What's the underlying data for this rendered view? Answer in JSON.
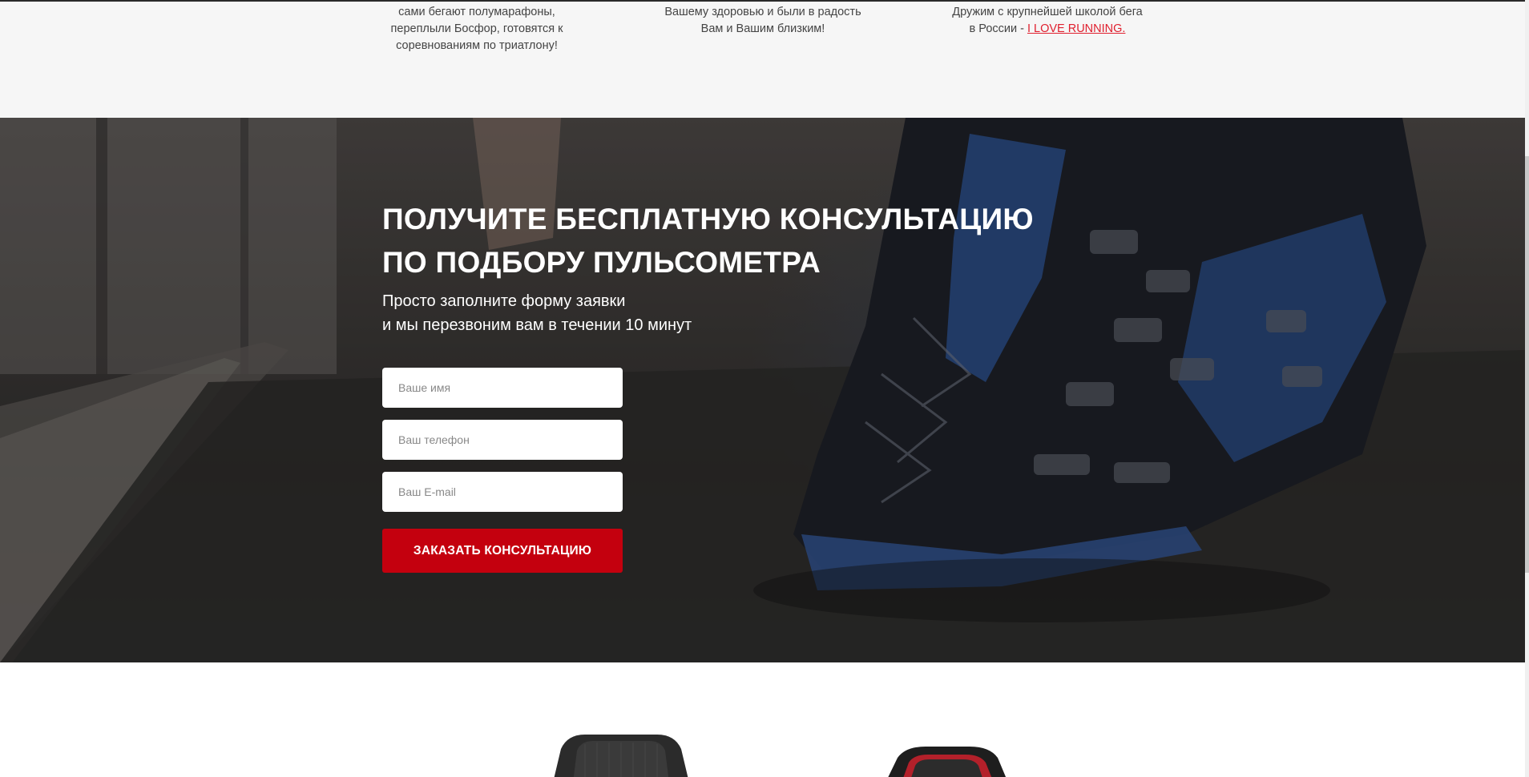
{
  "features": {
    "col1": {
      "line1": "сами бегают полумарафоны,",
      "line2": "переплыли Босфор, готовятся к",
      "line3": "соревнованиям по триатлону!"
    },
    "col2": {
      "line1": "Вашему здоровью и были в радость",
      "line2": "Вам и Вашим близким!"
    },
    "col3": {
      "line1": "Дружим с крупнейшей школой бега",
      "line2_prefix": "в России - ",
      "link": "I LOVE RUNNING."
    }
  },
  "consultation": {
    "title_line1": "ПОЛУЧИТЕ БЕСПЛАТНУЮ КОНСУЛЬТАЦИЮ",
    "title_line2": "ПО ПОДБОРУ ПУЛЬСОМЕТРА",
    "subtitle_line1": "Просто заполните форму заявки",
    "subtitle_line2": "и мы перезвоним вам в течении 10 минут",
    "form": {
      "name_placeholder": "Ваше имя",
      "name_value": "",
      "phone_placeholder": "Ваш телефон",
      "phone_value": "",
      "email_placeholder": "Ваш E-mail",
      "email_value": "",
      "submit_label": "ЗАКАЗАТЬ КОНСУЛЬТАЦИЮ"
    }
  },
  "colors": {
    "accent": "#c4000e",
    "link": "#e0202f",
    "features_bg": "#f6f6f6"
  },
  "icons": {
    "hero_background": "running-shoe-on-treadmill-photo",
    "product_1": "fitness-band-watch",
    "product_2": "gps-sport-watch"
  }
}
